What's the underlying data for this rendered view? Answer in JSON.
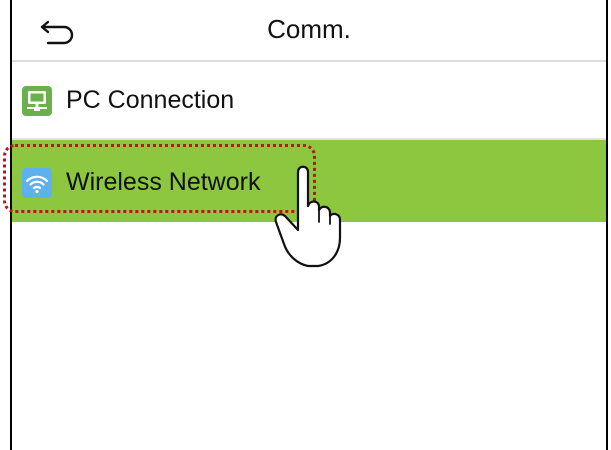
{
  "header": {
    "title": "Comm.",
    "back_icon": "back-arrow-icon"
  },
  "menu": {
    "items": [
      {
        "label": "PC Connection",
        "icon": "pc-connection-icon",
        "icon_color": "#6ab04c",
        "selected": false
      },
      {
        "label": "Wireless Network",
        "icon": "wifi-icon",
        "icon_color": "#5fb0ee",
        "selected": true
      }
    ]
  },
  "colors": {
    "selected_row": "#8dc63f",
    "highlight_outline": "#c0101a"
  },
  "annotation": {
    "pointer_icon": "tap-hand-icon",
    "highlight": "dotted-outline"
  }
}
